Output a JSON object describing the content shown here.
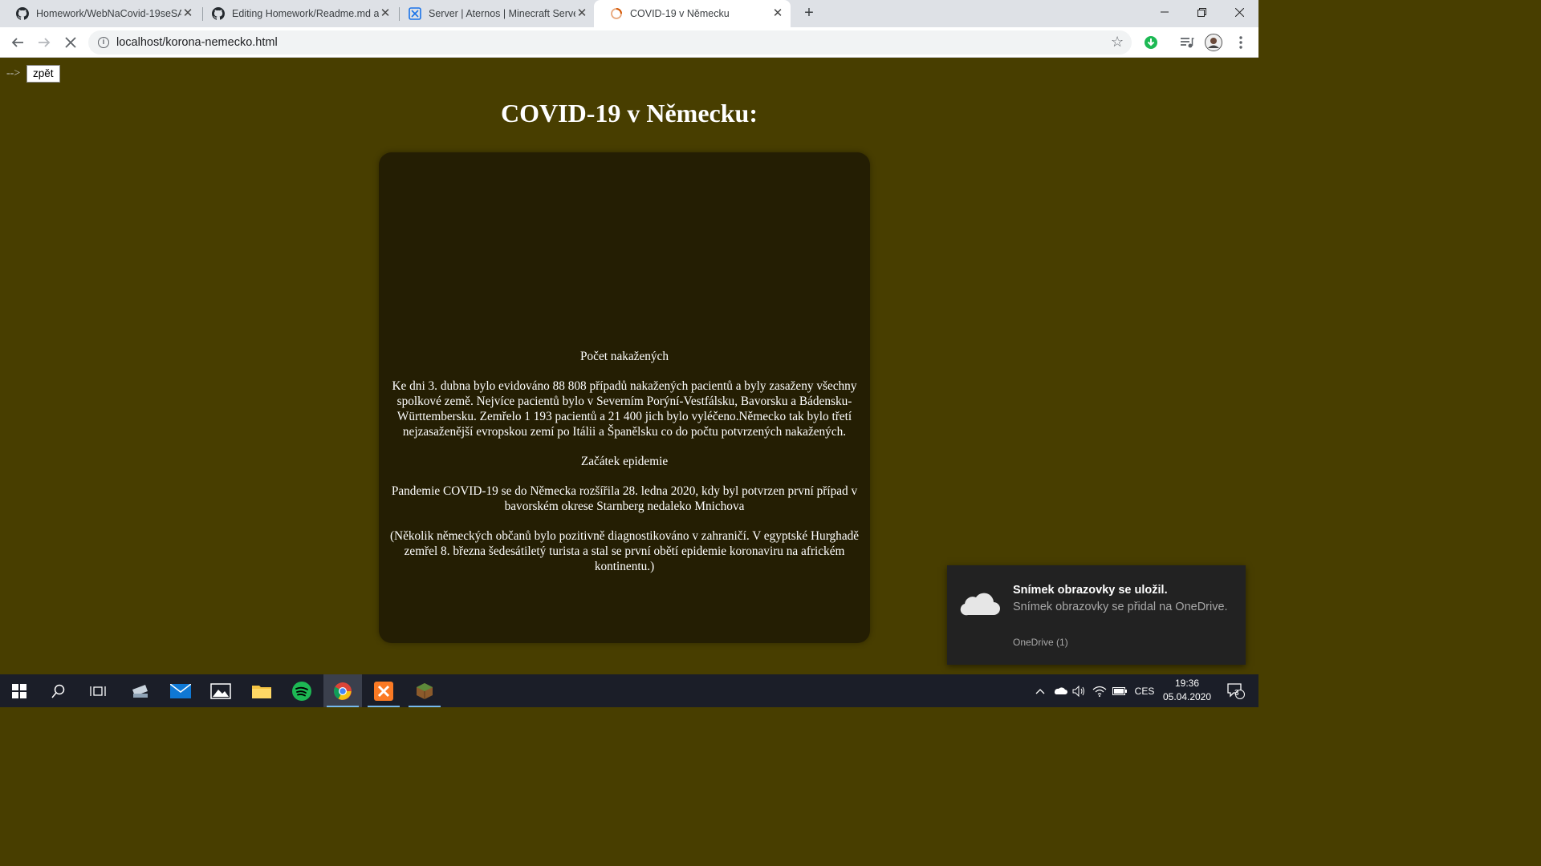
{
  "browser": {
    "tabs": [
      {
        "title": "Homework/WebNaCovid-19seSA",
        "icon": "github-icon",
        "active": false
      },
      {
        "title": "Editing Homework/Readme.md a",
        "icon": "github-icon",
        "active": false
      },
      {
        "title": "Server | Aternos | Minecraft Serve",
        "icon": "aternos-icon",
        "active": false
      },
      {
        "title": "COVID-19 v Německu",
        "icon": "loading-icon",
        "active": true
      }
    ],
    "url": "localhost/korona-nemecko.html"
  },
  "page": {
    "comment_arrow": "-->",
    "back_button": "zpět",
    "title": "COVID-19 v Německu:",
    "card": {
      "heading_infected": "Počet nakažených",
      "paragraph_infected": "Ke dni 3. dubna bylo evidováno 88 808 případů nakažených pacientů a byly zasaženy všechny spolkové země. Nejvíce pacientů bylo v Severním Porýní-Vestfálsku, Bavorsku a Bádensku-Württembersku. Zemřelo 1 193 pacientů a 21 400 jich bylo vyléčeno.Německo tak bylo třetí nejzasaženější evropskou zemí po Itálii a Španělsku co do počtu potvrzených nakažených.",
      "heading_start": "Začátek epidemie",
      "paragraph_start": "Pandemie COVID-19 se do Německa rozšířila 28. ledna 2020, kdy byl potvrzen první případ v bavorském okrese Starnberg nedaleko Mnichova",
      "paragraph_note": "(Několik německých občanů bylo pozitivně diagnostikováno v zahraničí. V egyptské Hurghadě zemřel 8. března šedesátiletý turista a stal se první obětí epidemie koronaviru na africkém kontinentu.)"
    },
    "colors": {
      "background": "#483e00",
      "card": "#241e03"
    }
  },
  "notification": {
    "title": "Snímek obrazovky se uložil.",
    "body": "Snímek obrazovky se přidal na OneDrive.",
    "source": "OneDrive (1)"
  },
  "taskbar": {
    "language": "CES",
    "time": "19:36",
    "date": "05.04.2020",
    "notification_count": "3"
  }
}
